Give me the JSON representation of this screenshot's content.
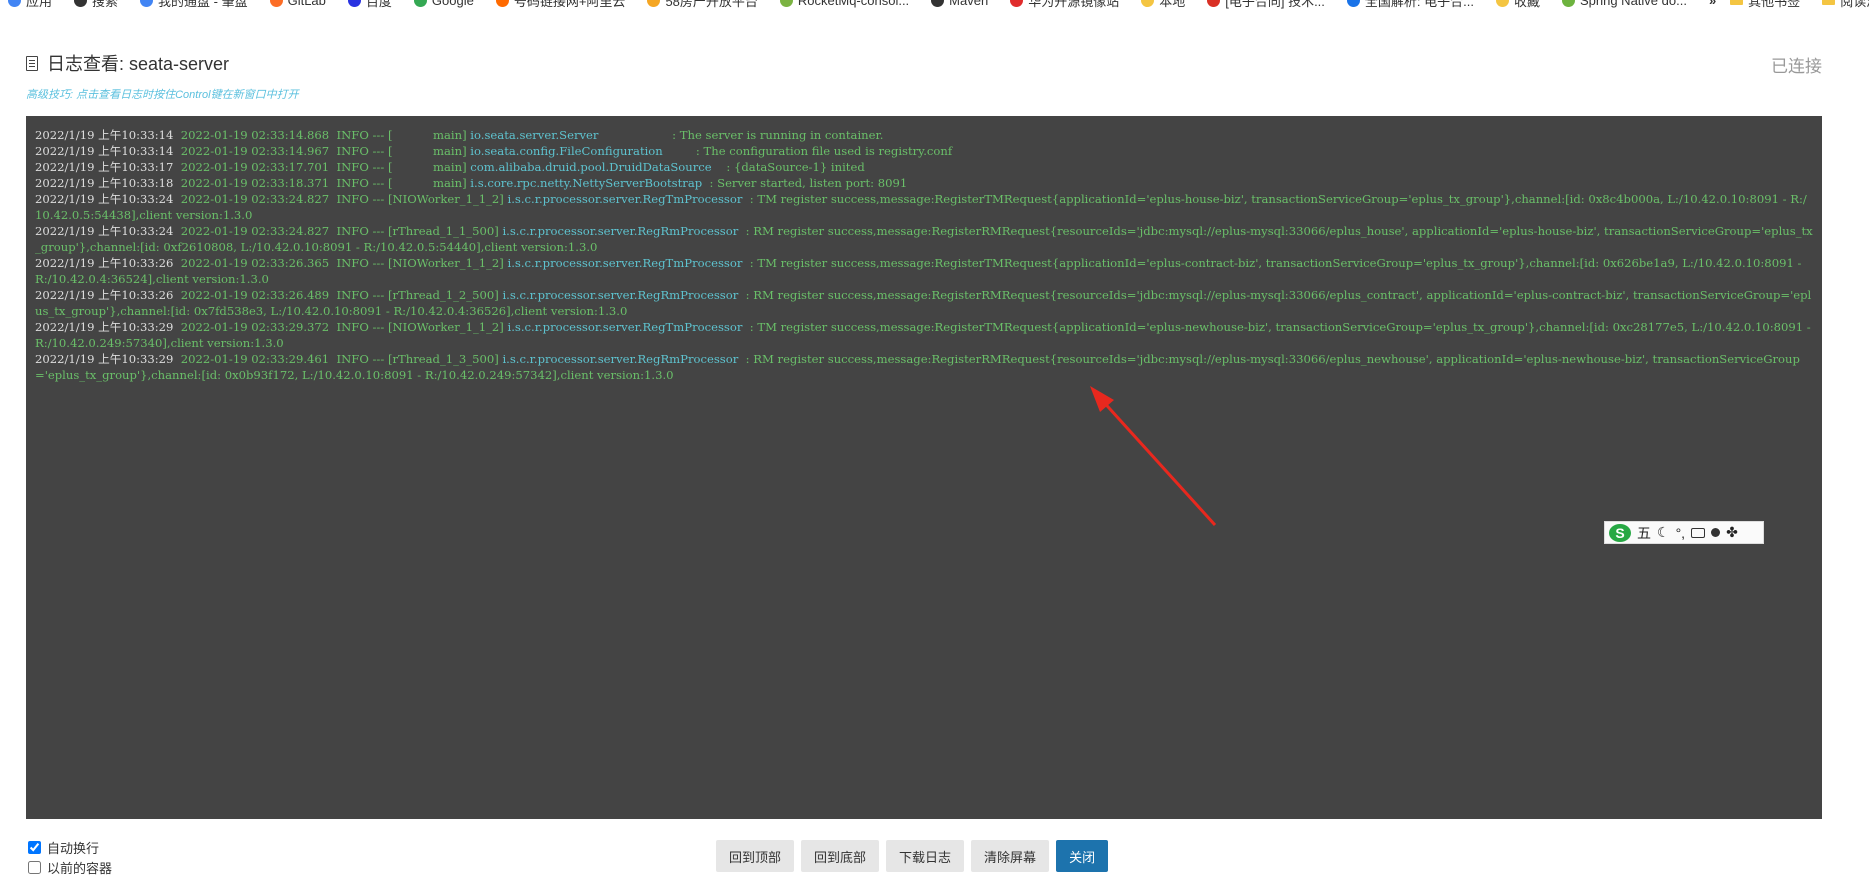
{
  "bookmarks": [
    {
      "label": "应用",
      "color": "#4285f4"
    },
    {
      "label": "搜索",
      "color": "#333333"
    },
    {
      "label": "我的通盘 - 筆盘",
      "color": "#4285f4"
    },
    {
      "label": "GitLab",
      "color": "#fc6d26"
    },
    {
      "label": "百度",
      "color": "#2932e1"
    },
    {
      "label": "Google",
      "color": "#34a853"
    },
    {
      "label": "号码链接网+阿里云",
      "color": "#ff6a00"
    },
    {
      "label": "58房产开放平台",
      "color": "#f5a623"
    },
    {
      "label": "RocketMq-consol...",
      "color": "#7bb342"
    },
    {
      "label": "Maven",
      "color": "#333333"
    },
    {
      "label": "华为开源镜像站",
      "color": "#e02c2c"
    },
    {
      "label": "本地",
      "color": "#f4c542"
    },
    {
      "label": "[电子合同] 技术...",
      "color": "#d93025"
    },
    {
      "label": "全国解析: 电子合...",
      "color": "#1a73e8"
    },
    {
      "label": "收藏",
      "color": "#f4c542"
    },
    {
      "label": "Spring Native do...",
      "color": "#6db33f"
    }
  ],
  "bookmarks_more": "»",
  "bookmarks_right": [
    {
      "label": "其他书签"
    },
    {
      "label": "阅读清单"
    }
  ],
  "header": {
    "title": "日志查看: seata-server",
    "status": "已连接",
    "tip": "高级技巧: 点击查看日志时按住Control键在新窗口中打开"
  },
  "log_lines": [
    {
      "ts": "2022/1/19 上午10:33:14",
      "pre": "  2022-01-19 02:33:14.868  INFO --- [           main] ",
      "logger": "io.seata.server.Server",
      "msg": "                    : The server is running in container."
    },
    {
      "ts": "2022/1/19 上午10:33:14",
      "pre": "  2022-01-19 02:33:14.967  INFO --- [           main] ",
      "logger": "io.seata.config.FileConfiguration",
      "msg": "         : The configuration file used is registry.conf"
    },
    {
      "ts": "2022/1/19 上午10:33:17",
      "pre": "  2022-01-19 02:33:17.701  INFO --- [           main] ",
      "logger": "com.alibaba.druid.pool.DruidDataSource",
      "msg": "    : {dataSource-1} inited"
    },
    {
      "ts": "2022/1/19 上午10:33:18",
      "pre": "  2022-01-19 02:33:18.371  INFO --- [           main] ",
      "logger": "i.s.core.rpc.netty.NettyServerBootstrap",
      "msg": "  : Server started, listen port: 8091"
    },
    {
      "ts": "2022/1/19 上午10:33:24",
      "pre": "  2022-01-19 02:33:24.827  INFO --- [NIOWorker_1_1_2] ",
      "logger": "i.s.c.r.processor.server.RegTmProcessor",
      "msg": "  : TM register success,message:RegisterTMRequest{applicationId='eplus-house-biz', transactionServiceGroup='eplus_tx_group'},channel:[id: 0x8c4b000a, L:/10.42.0.10:8091 - R:/10.42.0.5:54438],client version:1.3.0"
    },
    {
      "ts": "2022/1/19 上午10:33:24",
      "pre": "  2022-01-19 02:33:24.827  INFO --- [rThread_1_1_500] ",
      "logger": "i.s.c.r.processor.server.RegRmProcessor",
      "msg": "  : RM register success,message:RegisterRMRequest{resourceIds='jdbc:mysql://eplus-mysql:33066/eplus_house', applicationId='eplus-house-biz', transactionServiceGroup='eplus_tx_group'},channel:[id: 0xf2610808, L:/10.42.0.10:8091 - R:/10.42.0.5:54440],client version:1.3.0"
    },
    {
      "ts": "2022/1/19 上午10:33:26",
      "pre": "  2022-01-19 02:33:26.365  INFO --- [NIOWorker_1_1_2] ",
      "logger": "i.s.c.r.processor.server.RegTmProcessor",
      "msg": "  : TM register success,message:RegisterTMRequest{applicationId='eplus-contract-biz', transactionServiceGroup='eplus_tx_group'},channel:[id: 0x626be1a9, L:/10.42.0.10:8091 - R:/10.42.0.4:36524],client version:1.3.0"
    },
    {
      "ts": "2022/1/19 上午10:33:26",
      "pre": "  2022-01-19 02:33:26.489  INFO --- [rThread_1_2_500] ",
      "logger": "i.s.c.r.processor.server.RegRmProcessor",
      "msg": "  : RM register success,message:RegisterRMRequest{resourceIds='jdbc:mysql://eplus-mysql:33066/eplus_contract', applicationId='eplus-contract-biz', transactionServiceGroup='eplus_tx_group'},channel:[id: 0x7fd538e3, L:/10.42.0.10:8091 - R:/10.42.0.4:36526],client version:1.3.0"
    },
    {
      "ts": "2022/1/19 上午10:33:29",
      "pre": "  2022-01-19 02:33:29.372  INFO --- [NIOWorker_1_1_2] ",
      "logger": "i.s.c.r.processor.server.RegTmProcessor",
      "msg": "  : TM register success,message:RegisterTMRequest{applicationId='eplus-newhouse-biz', transactionServiceGroup='eplus_tx_group'},channel:[id: 0xc28177e5, L:/10.42.0.10:8091 - R:/10.42.0.249:57340],client version:1.3.0"
    },
    {
      "ts": "2022/1/19 上午10:33:29",
      "pre": "  2022-01-19 02:33:29.461  INFO --- [rThread_1_3_500] ",
      "logger": "i.s.c.r.processor.server.RegRmProcessor",
      "msg": "  : RM register success,message:RegisterRMRequest{resourceIds='jdbc:mysql://eplus-mysql:33066/eplus_newhouse', applicationId='eplus-newhouse-biz', transactionServiceGroup='eplus_tx_group'},channel:[id: 0x0b93f172, L:/10.42.0.10:8091 - R:/10.42.0.249:57342],client version:1.3.0"
    }
  ],
  "ime_toolbar": {
    "logo": "S",
    "mode": "五",
    "icons": [
      "moon-icon",
      "punctuation-icon",
      "keyboard-icon",
      "user-icon",
      "grid-icon"
    ]
  },
  "options": {
    "auto_wrap": {
      "label": "自动换行",
      "checked": true
    },
    "previous_container": {
      "label": "以前的容器",
      "checked": false
    }
  },
  "buttons": {
    "top": "回到顶部",
    "bottom": "回到底部",
    "download": "下载日志",
    "clear": "清除屏幕",
    "close": "关闭"
  },
  "colors": {
    "console_bg": "#444444",
    "log_text": "#6abf69",
    "logger": "#5ec3cf",
    "primary_button": "#1d73ad",
    "arrow": "#e8281e"
  }
}
